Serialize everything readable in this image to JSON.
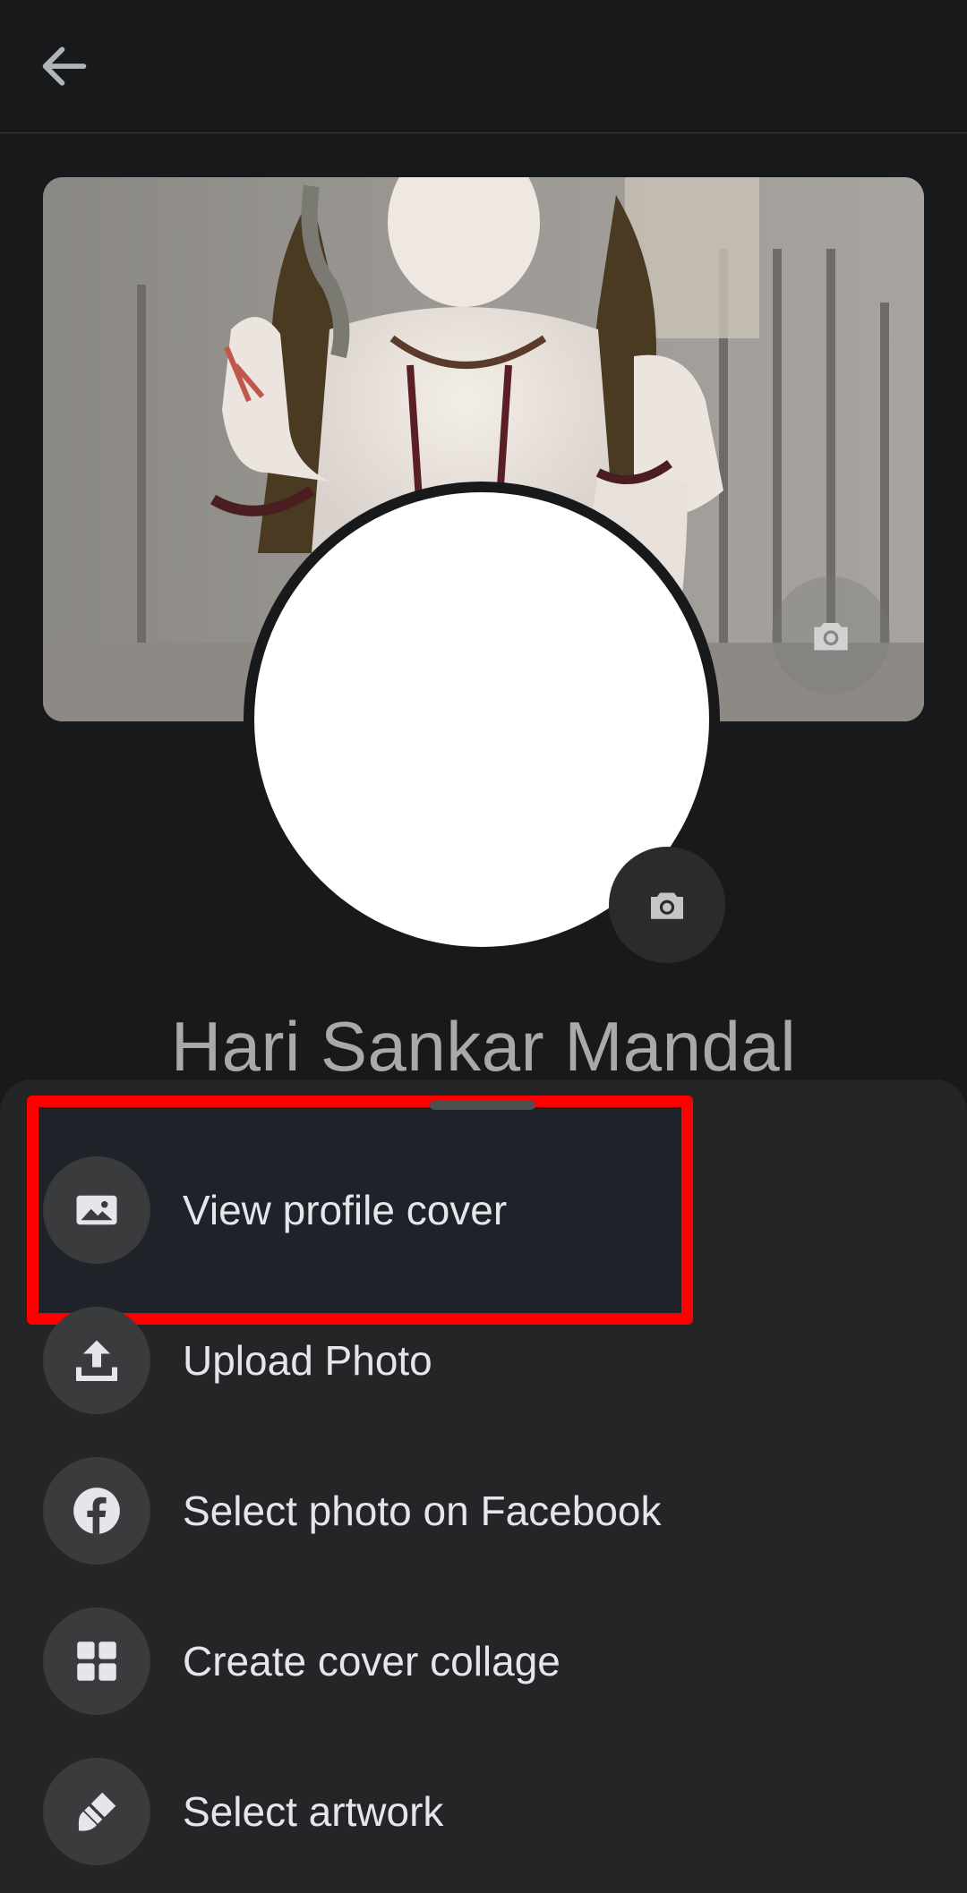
{
  "header": {
    "back_icon": "arrow-left-icon"
  },
  "cover": {
    "camera_icon": "camera-icon"
  },
  "avatar": {
    "camera_icon": "camera-icon"
  },
  "profile": {
    "name": "Hari Sankar Mandal"
  },
  "sheet": {
    "highlight_color": "#ff0000",
    "items": [
      {
        "label": "View profile cover",
        "icon": "image-icon"
      },
      {
        "label": "Upload Photo",
        "icon": "upload-icon"
      },
      {
        "label": "Select photo on Facebook",
        "icon": "facebook-icon"
      },
      {
        "label": "Create cover collage",
        "icon": "grid-icon"
      },
      {
        "label": "Select artwork",
        "icon": "paintbrush-icon"
      }
    ]
  }
}
